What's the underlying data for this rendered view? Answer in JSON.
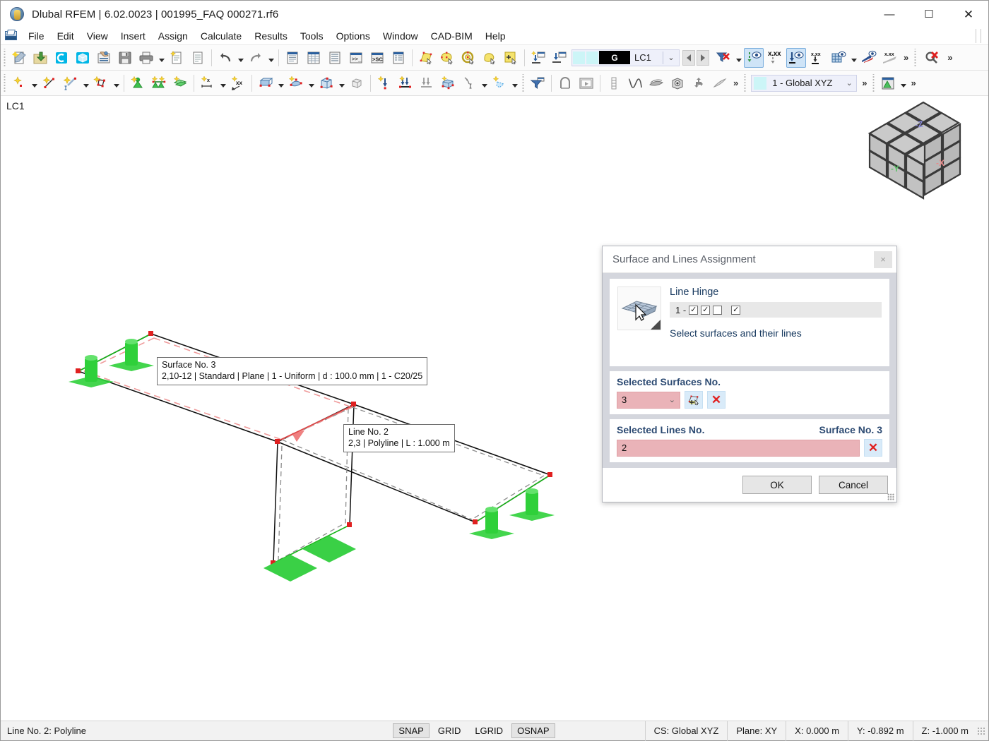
{
  "window": {
    "title": "Dlubal RFEM | 6.02.0023 | 001995_FAQ 000271.rf6",
    "icon": "app-globe-icon",
    "minimize": "—",
    "maximize": "☐",
    "close": "✕"
  },
  "menu": {
    "items": [
      "File",
      "Edit",
      "View",
      "Insert",
      "Assign",
      "Calculate",
      "Results",
      "Tools",
      "Options",
      "Window",
      "CAD-BIM",
      "Help"
    ]
  },
  "toolbar1": {
    "load_case_selector": {
      "g_label": "G",
      "value": "LC1",
      "caret": "⌄"
    },
    "overflow": "»",
    "xxx_label": "x.xx"
  },
  "toolbar2": {
    "coordinate_system": {
      "value": "1 - Global XYZ",
      "caret": "⌄"
    },
    "overflow": "»"
  },
  "workarea": {
    "load_case_tag": "LC1",
    "navcube": {
      "top_axis": "-Z",
      "left_axis": "-Y",
      "right_axis": "-X"
    },
    "tooltips": [
      {
        "name": "surface-tooltip",
        "line1": "Surface No. 3",
        "line2": "2,10-12 | Standard | Plane | 1 - Uniform | d : 100.0 mm | 1 - C20/25"
      },
      {
        "name": "line-tooltip",
        "line1": "Line No. 2",
        "line2": "2,3 | Polyline | L : 1.000 m"
      }
    ]
  },
  "dialog": {
    "title": "Surface and Lines Assignment",
    "close_glyph": "×",
    "hinge": {
      "label": "Line Hinge",
      "value_prefix": "1 - ",
      "checkboxes": [
        true,
        true,
        false,
        true
      ],
      "check_glyph": "✓",
      "hint": "Select surfaces and their lines"
    },
    "surfaces_section": {
      "title": "Selected Surfaces No.",
      "value": "3",
      "caret": "⌄",
      "pick_icon": "pick-surface-icon",
      "clear_glyph": "✕"
    },
    "lines_section": {
      "title": "Selected Lines No.",
      "right_label": "Surface No. 3",
      "value": "2",
      "clear_glyph": "✕"
    },
    "buttons": {
      "ok": "OK",
      "cancel": "Cancel"
    }
  },
  "statusbar": {
    "message": "Line No. 2: Polyline",
    "toggles": [
      {
        "label": "SNAP",
        "active": true
      },
      {
        "label": "GRID",
        "active": false
      },
      {
        "label": "LGRID",
        "active": false
      },
      {
        "label": "OSNAP",
        "active": true
      }
    ],
    "cs": "CS: Global XYZ",
    "plane": "Plane: XY",
    "x": "X: 0.000 m",
    "y": "Y: -0.892 m",
    "z": "Z: -1.000 m"
  }
}
